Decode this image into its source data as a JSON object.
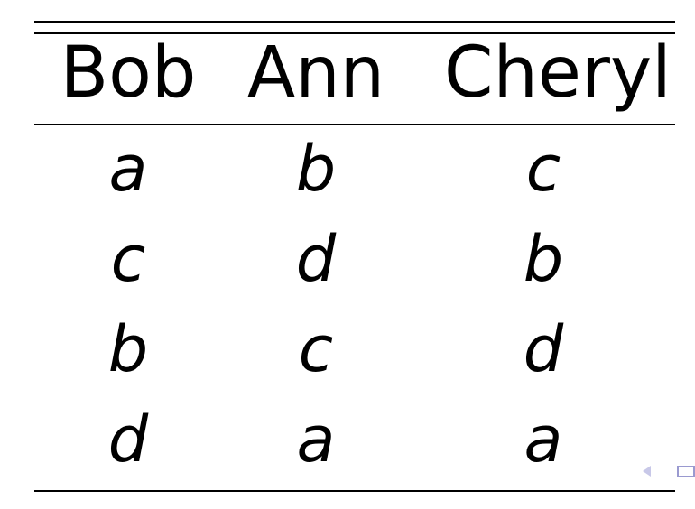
{
  "table": {
    "headers": [
      "Bob",
      "Ann",
      "Cheryl"
    ],
    "rows": [
      [
        "a",
        "b",
        "c"
      ],
      [
        "c",
        "d",
        "b"
      ],
      [
        "b",
        "c",
        "d"
      ],
      [
        "d",
        "a",
        "a"
      ]
    ]
  },
  "navigation": {
    "prev_icon": "triangle-left-icon",
    "frame_icon": "frame-icon",
    "icon_colors": [
      "#c8c8e8",
      "#9a9ad0"
    ]
  }
}
